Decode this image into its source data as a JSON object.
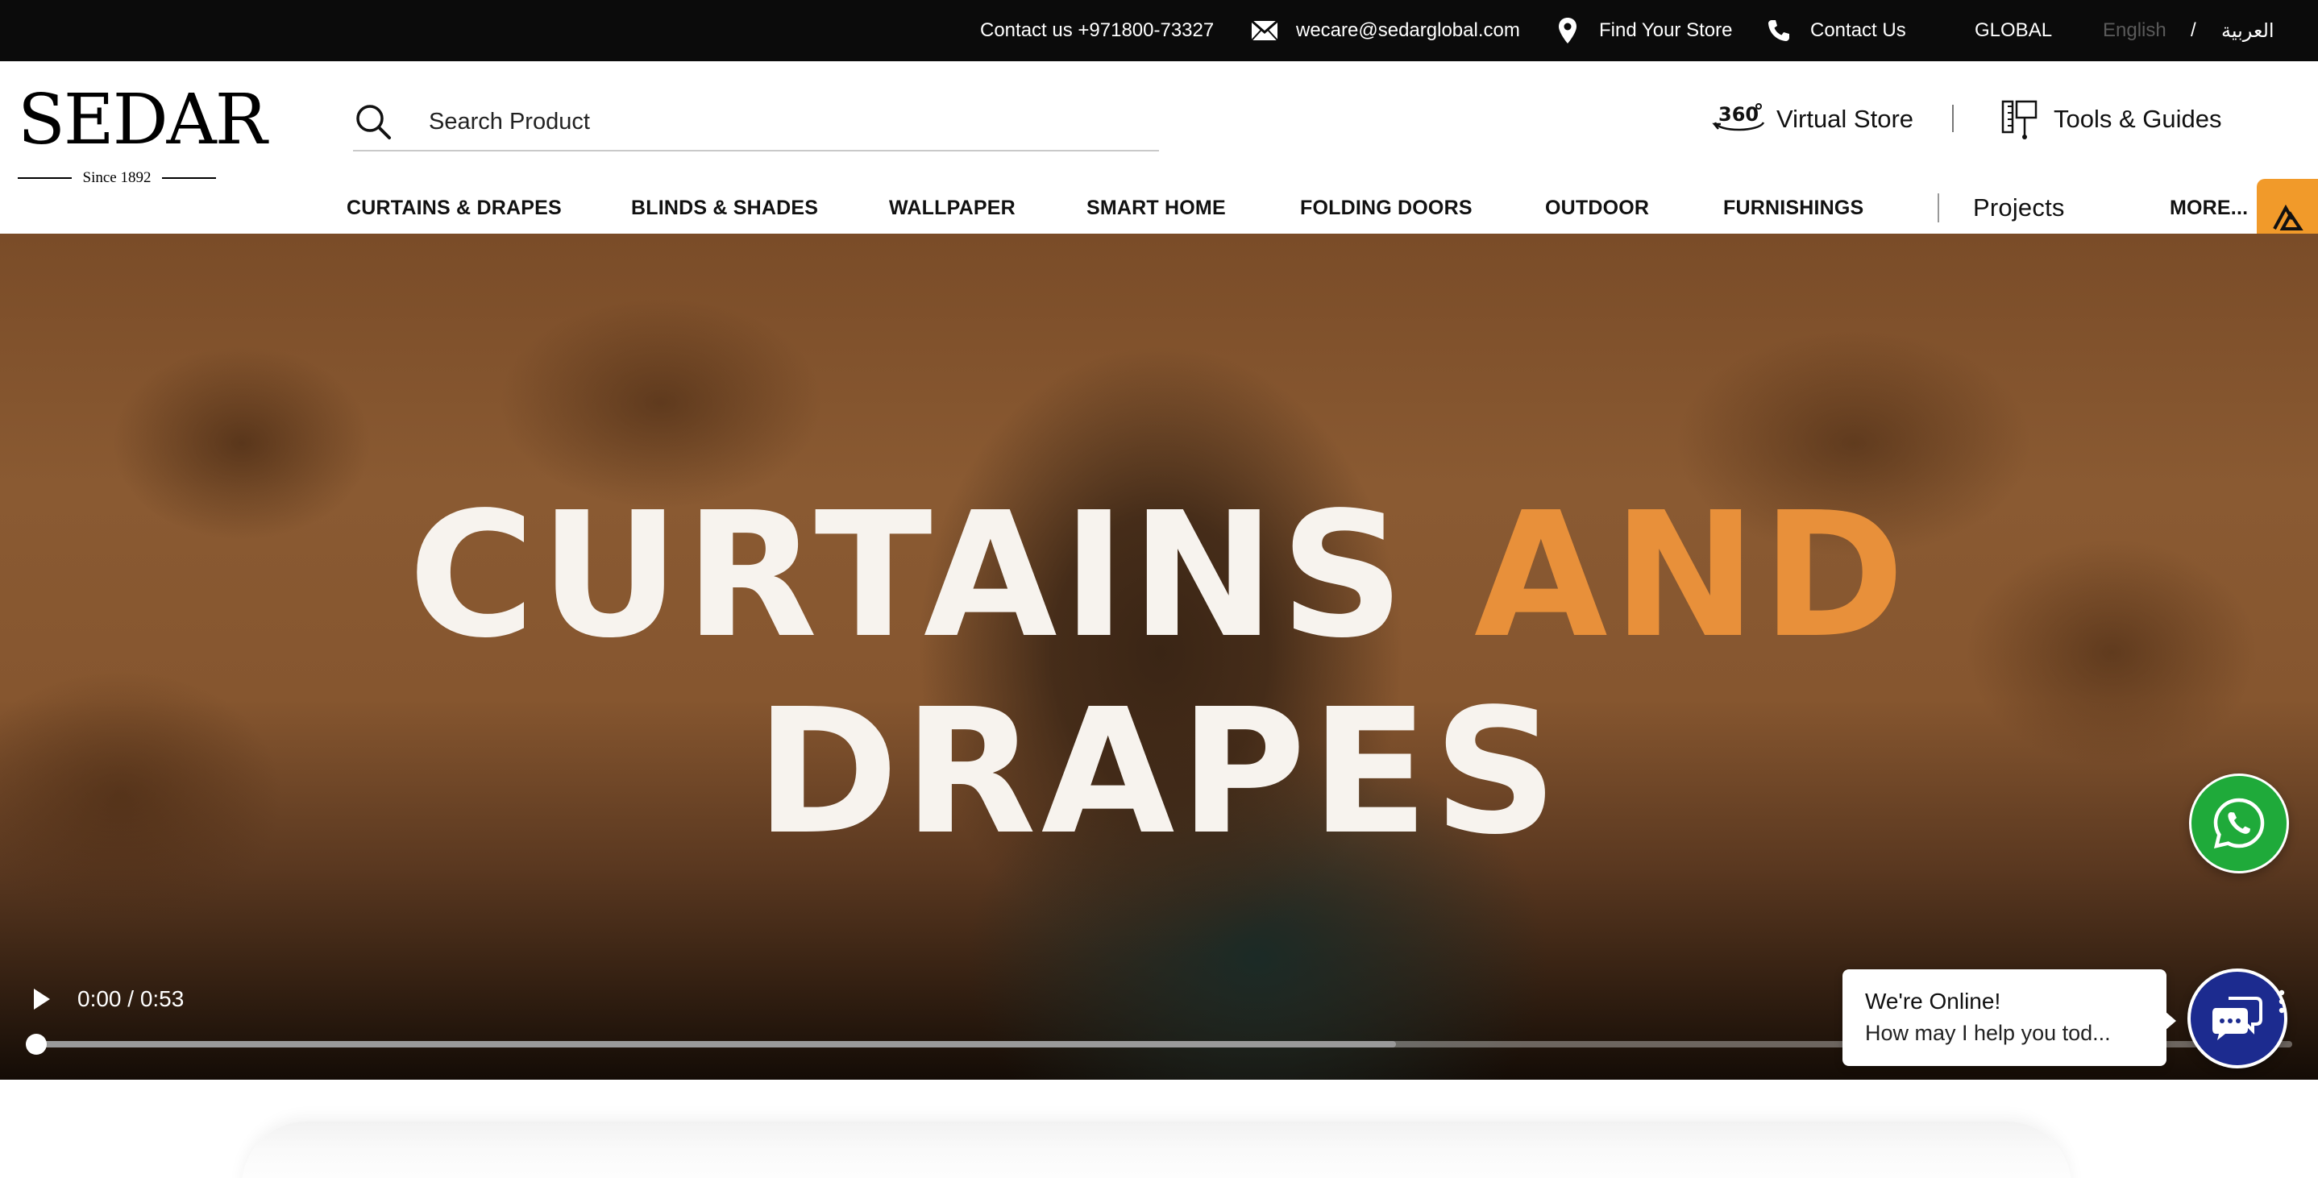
{
  "topbar": {
    "phone": "Contact us +971800-73327",
    "email": "wecare@sedarglobal.com",
    "find_store": "Find Your Store",
    "contact": "Contact Us",
    "region": "GLOBAL",
    "lang_en": "English",
    "lang_sep": "/",
    "lang_ar": "العربية"
  },
  "header": {
    "logo_text": "SEDAR",
    "logo_tagline": "Since 1892",
    "search_placeholder": "Search Product",
    "virtual_store": "Virtual Store",
    "tools_guides": "Tools & Guides"
  },
  "nav": {
    "items": [
      "CURTAINS & DRAPES",
      "BLINDS & SHADES",
      "WALLPAPER",
      "SMART HOME",
      "FOLDING DOORS",
      "OUTDOOR",
      "FURNISHINGS"
    ],
    "projects": "Projects",
    "more": "MORE..."
  },
  "hero": {
    "title_word1": "CURTAINS",
    "title_word2": "AND",
    "title_line2": "DRAPES",
    "time": "0:00 / 0:53",
    "progress_fraction": 0.0
  },
  "chat": {
    "title": "We're Online!",
    "message": "How may I help you tod..."
  },
  "colors": {
    "accent_orange": "#e8903a",
    "tab_orange": "#f19a2a",
    "whatsapp_green": "#1faa3a",
    "chat_blue": "#1c2b8f"
  },
  "icons": [
    "mail-icon",
    "location-pin-icon",
    "phone-icon",
    "search-icon",
    "view-360-icon",
    "tools-guides-icon",
    "chevron-down-icon",
    "play-icon",
    "whatsapp-icon",
    "chat-icon",
    "kebab-menu-icon"
  ]
}
